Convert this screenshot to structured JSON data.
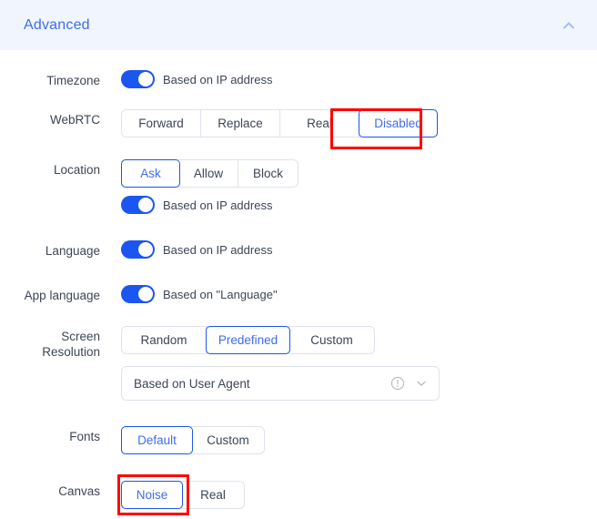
{
  "header": {
    "title": "Advanced",
    "collapse_icon": "chevron-up-icon"
  },
  "rows": {
    "timezone": {
      "label": "Timezone",
      "toggle_label": "Based on IP address",
      "toggle_on": true
    },
    "webrtc": {
      "label": "WebRTC",
      "options": [
        "Forward",
        "Replace",
        "Real",
        "Disabled"
      ],
      "selected": "Disabled",
      "highlighted": true
    },
    "location": {
      "label": "Location",
      "options": [
        "Ask",
        "Allow",
        "Block"
      ],
      "selected": "Ask",
      "toggle_label": "Based on IP address",
      "toggle_on": true
    },
    "language": {
      "label": "Language",
      "toggle_label": "Based on IP address",
      "toggle_on": true
    },
    "app_language": {
      "label": "App language",
      "toggle_label": "Based on \"Language\"",
      "toggle_on": true
    },
    "screen_resolution": {
      "label": "Screen Resolution",
      "options": [
        "Random",
        "Predefined",
        "Custom"
      ],
      "selected": "Predefined",
      "dropdown_value": "Based on User Agent",
      "dropdown_info_icon": "exclamation-circle-icon",
      "dropdown_arrow_icon": "chevron-down-icon"
    },
    "fonts": {
      "label": "Fonts",
      "options": [
        "Default",
        "Custom"
      ],
      "selected": "Default"
    },
    "canvas": {
      "label": "Canvas",
      "options": [
        "Noise",
        "Real"
      ],
      "selected": "Noise",
      "highlighted": true
    }
  },
  "colors": {
    "header_bg": "#f1f5fe",
    "accent": "#3d6df0",
    "toggle_on": "#1b56f0",
    "highlight": "#ff0000",
    "border": "#dfe3ea",
    "text": "#3b4754"
  }
}
